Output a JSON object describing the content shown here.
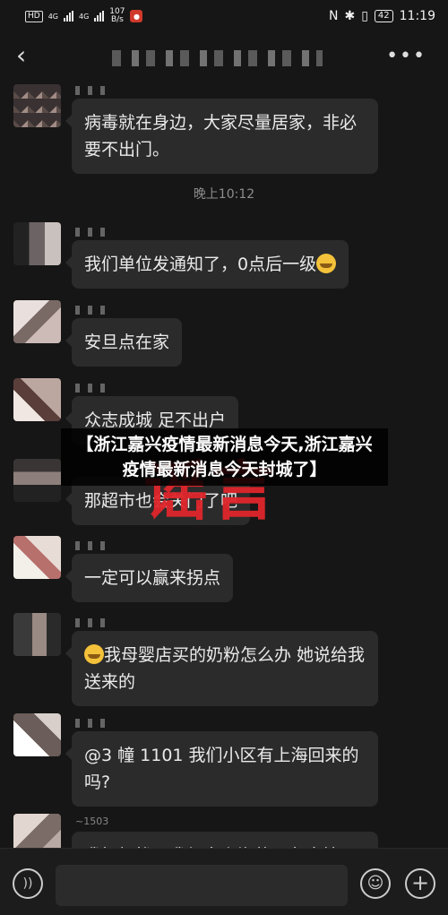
{
  "status_bar": {
    "hd_badge": "HD",
    "network_1": "4G",
    "network_2": "4G",
    "speed_value": "107",
    "speed_unit": "B/s",
    "time": "11:19",
    "battery": "42"
  },
  "headline_overlay": "【浙江嘉兴疫情最新消息今天,浙江嘉兴疫情最新消息今天封城了】",
  "rumor_stamp": "谣言",
  "messages": [
    {
      "text": "病毒就在身边，大家尽量居家，非必要不出门。"
    },
    {
      "time_label": "晚上10:12"
    },
    {
      "text": "我们单位发通知了，0点后一级"
    },
    {
      "text": "安旦点在家"
    },
    {
      "text": "众志成城 足不出户"
    },
    {
      "text": "那超市也会关门了吧"
    },
    {
      "text": "一定可以赢来拐点"
    },
    {
      "text": "我母婴店买的奶粉怎么办 她说给我送来的"
    },
    {
      "text": "@3 幢 1101  我们小区有上海回来的吗?"
    },
    {
      "text": "我好担忧，我很多上海的朋友大樯"
    }
  ],
  "bottom_sender_partial": "~1503",
  "input": {
    "placeholder": ""
  }
}
